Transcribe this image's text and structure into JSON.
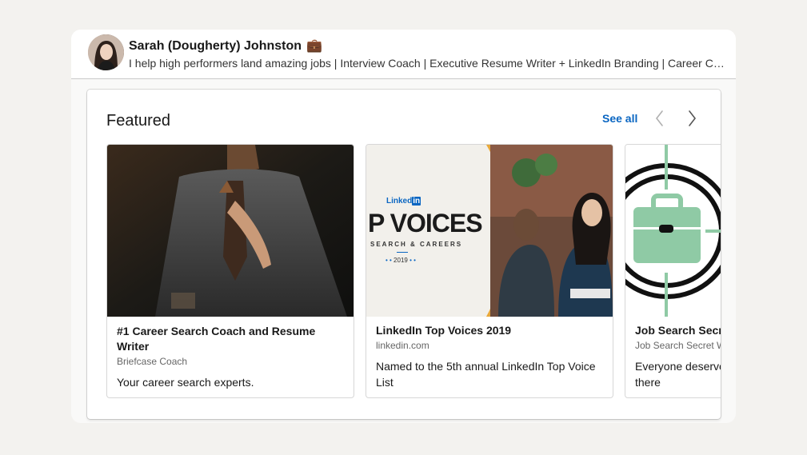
{
  "profile": {
    "name": "Sarah (Dougherty) Johnston",
    "badge": "💼",
    "headline": "I help high performers land amazing jobs | Interview Coach | Executive Resume Writer + LinkedIn Branding | Career Coach"
  },
  "featured": {
    "title": "Featured",
    "see_all": "See all",
    "prev_icon": "chevron-left-icon",
    "next_icon": "chevron-right-icon",
    "items": [
      {
        "title": "#1 Career Search Coach and Resume Writer",
        "subtitle": "Briefcase Coach",
        "description": "Your career search experts."
      },
      {
        "title": "LinkedIn Top Voices 2019",
        "subtitle": "linkedin.com",
        "description": "Named to the 5th annual LinkedIn Top Voice List",
        "image_text": {
          "brand": "Linked",
          "brand_in": "in",
          "headline": "P VOICES",
          "sub": "SEARCH & CAREERS",
          "year": "2019"
        }
      },
      {
        "title": "Job Search Secret",
        "subtitle": "Job Search Secret Weapon",
        "description": "Everyone deserves a great job, often getting there"
      }
    ]
  },
  "colors": {
    "link": "#0a66c2",
    "briefcase_green": "#8fcaa5",
    "voices_yellow": "#e8a83a"
  }
}
